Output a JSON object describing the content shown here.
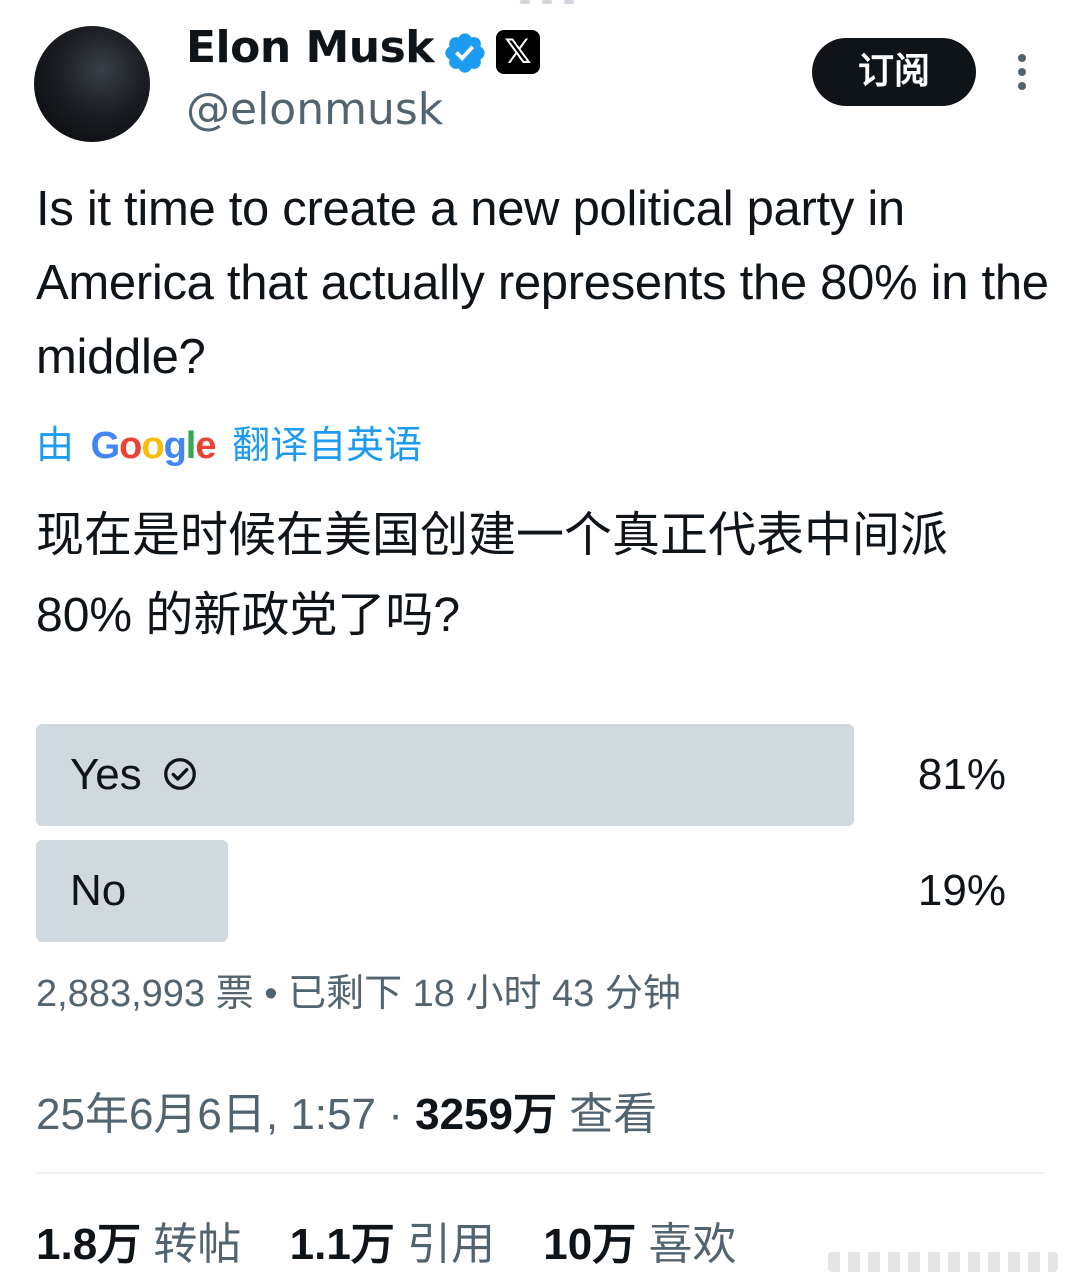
{
  "author": {
    "name": "Elon Musk",
    "handle": "@elonmusk",
    "x_badge": "𝕏",
    "verified_color": "#1d9bf0"
  },
  "header": {
    "subscribe_label": "订阅",
    "more_icon": "more-vertical-icon"
  },
  "tweet": {
    "text": "Is it time to create a new political party in America that actually represents the 80% in the middle?",
    "translation_prefix": "由",
    "translation_google": "Google",
    "translation_suffix": "翻译自英语",
    "translated_text": "现在是时候在美国创建一个真正代表中间派 80% 的新政党了吗?"
  },
  "poll": {
    "options": [
      {
        "label": "Yes",
        "percent_text": "81%",
        "percent": 81,
        "selected": true
      },
      {
        "label": "No",
        "percent_text": "19%",
        "percent": 19,
        "selected": false
      }
    ],
    "votes": "2,883,993 票",
    "separator": "•",
    "remaining": "已剩下 18 小时 43 分钟"
  },
  "meta": {
    "timestamp": "25年6月6日, 1:57",
    "dot": "·",
    "views_count": "3259万",
    "views_label": "查看"
  },
  "stats": {
    "reposts_count": "1.8万",
    "reposts_label": "转帖",
    "quotes_count": "1.1万",
    "quotes_label": "引用",
    "likes_count": "10万",
    "likes_label": "喜欢"
  },
  "colors": {
    "accent": "#1d9bf0",
    "poll_bar": "#cfd9de",
    "muted_text": "#536471",
    "text": "#0f1419"
  }
}
